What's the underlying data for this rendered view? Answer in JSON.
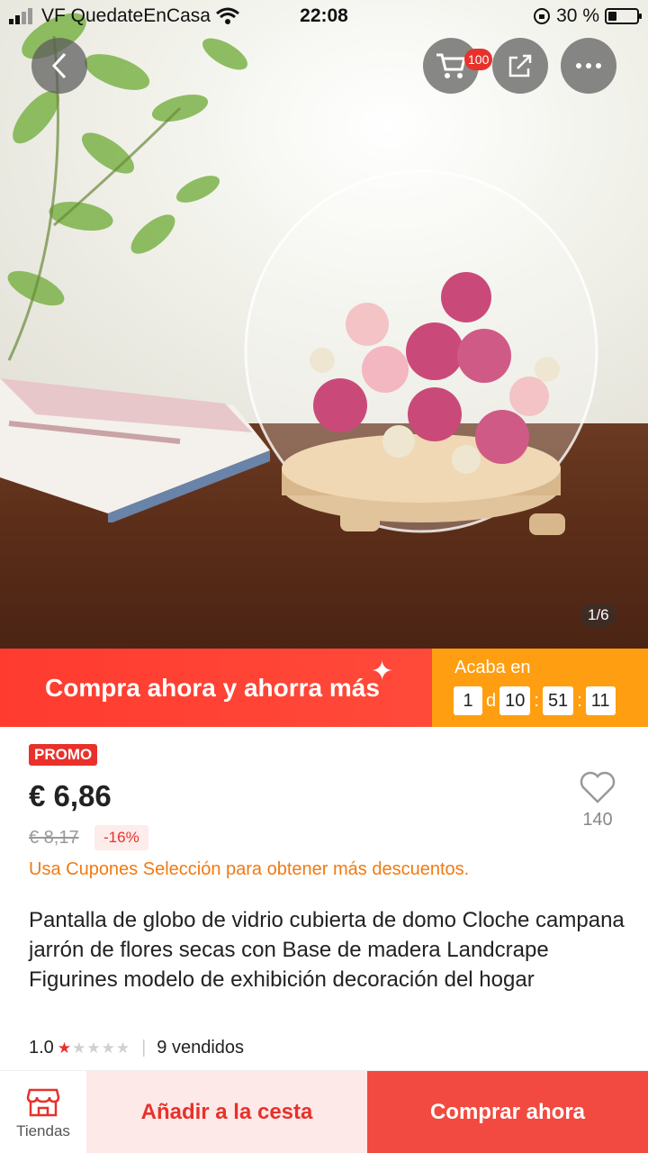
{
  "status_bar": {
    "carrier": "VF QuedateEnCasa",
    "time": "22:08",
    "battery": "30 %",
    "battery_level": 0.3
  },
  "header": {
    "cart_badge": "100"
  },
  "gallery": {
    "page_indicator": "1/6"
  },
  "promo_banner": {
    "text": "Compra ahora y ahorra más",
    "ends_label": "Acaba en",
    "countdown": {
      "days": "1",
      "day_unit": "d",
      "hours": "10",
      "minutes": "51",
      "seconds": "11"
    }
  },
  "product": {
    "promo_tag": "PROMO",
    "price": "€ 6,86",
    "old_price": "€ 8,17",
    "discount": "-16%",
    "wishlist_count": "140",
    "coupon_text": "Usa Cupones Selección para obtener más descuentos.",
    "title": "Pantalla de globo de vidrio cubierta de domo Cloche campana jarrón de flores secas con Base de madera Landcrape Figurines modelo de exhibición decoración del hogar",
    "rating": "1.0",
    "rating_stars": 1,
    "sold": "9 vendidos"
  },
  "bottom_bar": {
    "stores_label": "Tiendas",
    "add_to_cart": "Añadir a la cesta",
    "buy_now": "Comprar ahora"
  },
  "colors": {
    "accent_red": "#e8312b",
    "promo_orange": "#ff9e10",
    "coupon_orange": "#f07a11"
  }
}
